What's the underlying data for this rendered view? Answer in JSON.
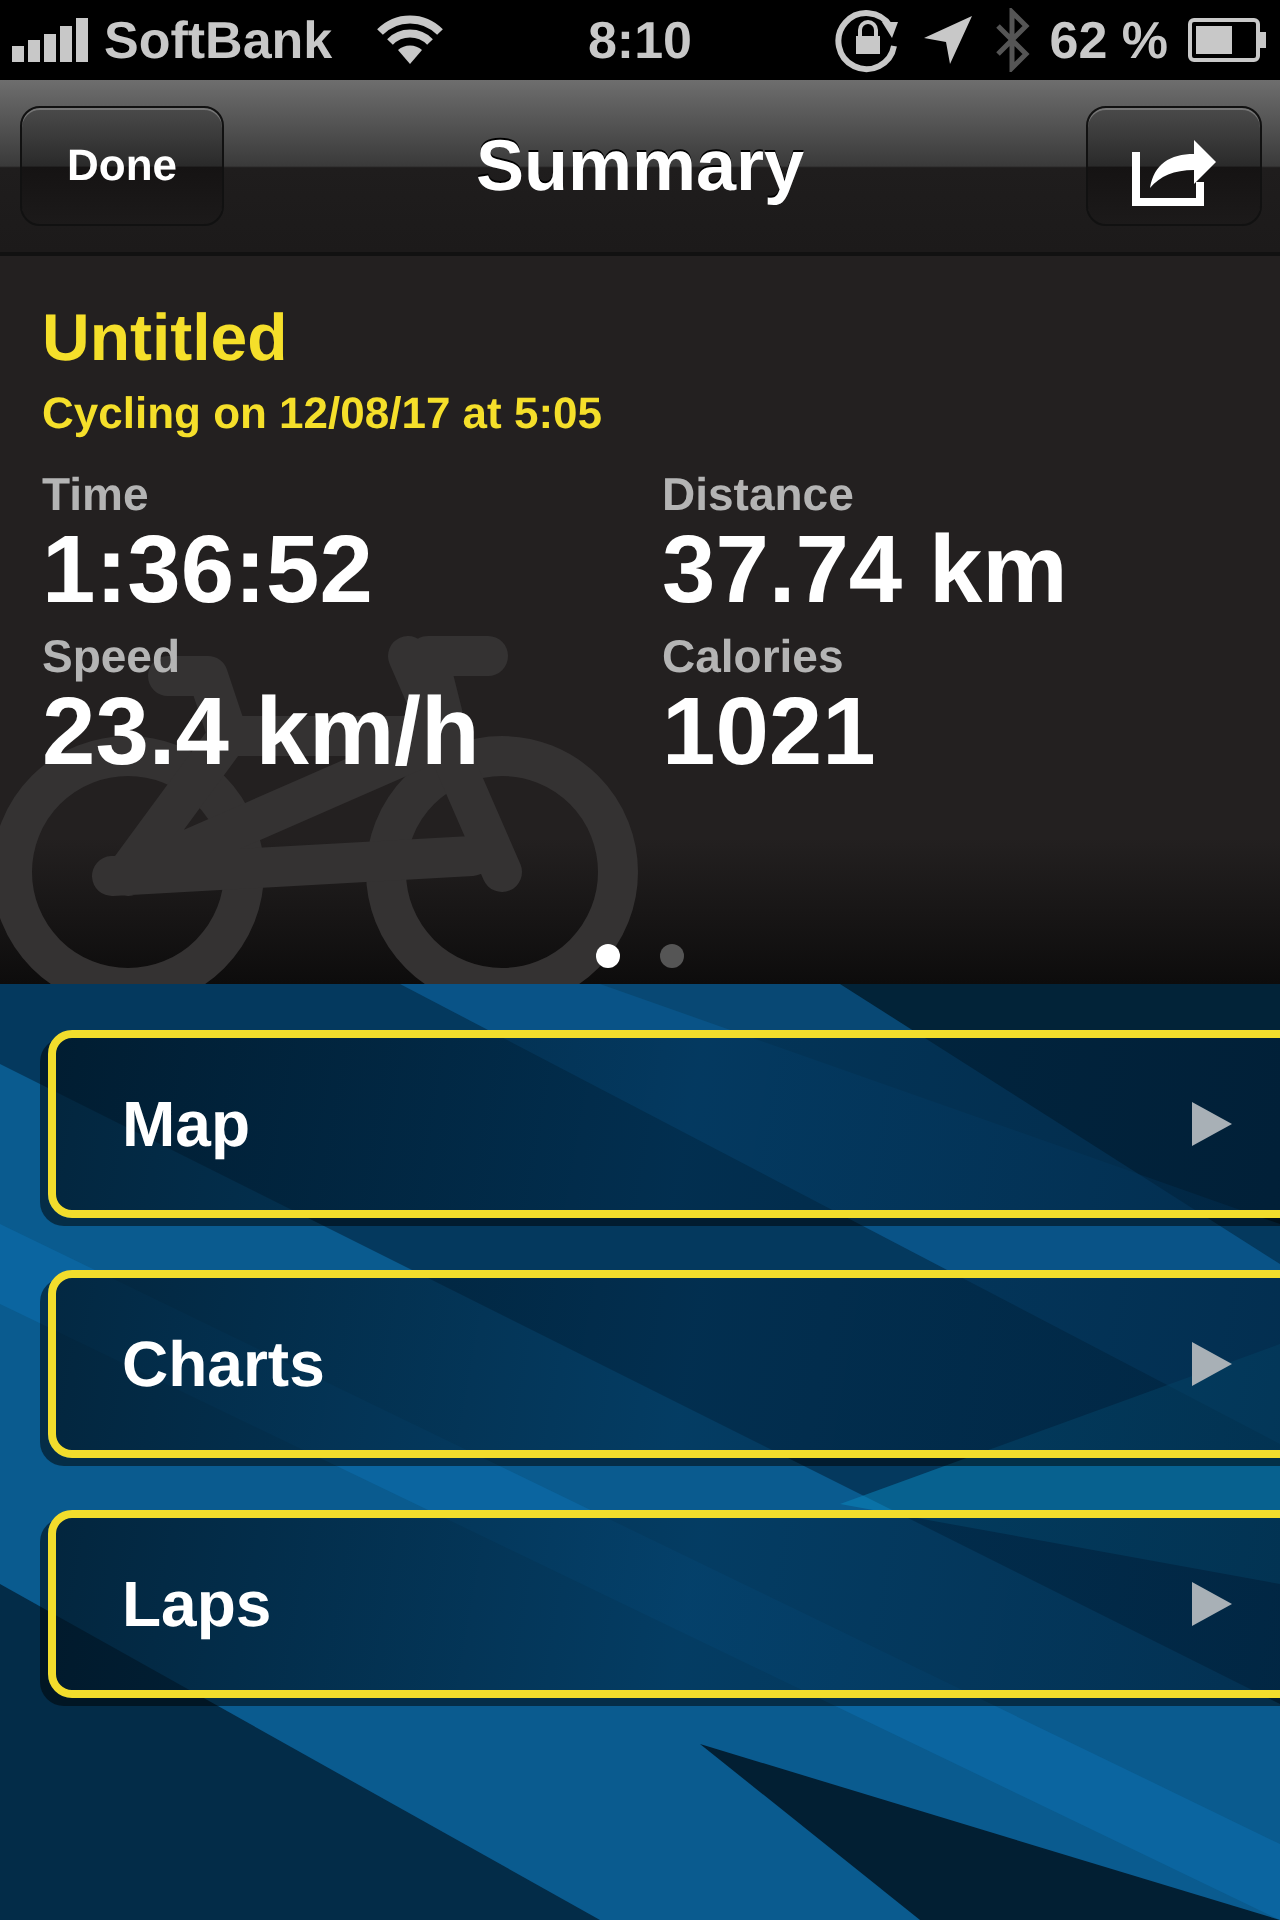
{
  "status_bar": {
    "carrier": "SoftBank",
    "time": "8:10",
    "battery": "62 %"
  },
  "nav_bar": {
    "title": "Summary",
    "left_button": "Done"
  },
  "summary": {
    "title": "Untitled",
    "subtitle": "Cycling on 12/08/17 at 5:05",
    "stats": [
      {
        "label": "Time",
        "value": "1:36:52"
      },
      {
        "label": "Distance",
        "value": "37.74 km"
      },
      {
        "label": "Speed",
        "value": "23.4 km/h"
      },
      {
        "label": "Calories",
        "value": "1021"
      }
    ],
    "pages": [
      {
        "selected": true
      },
      {
        "selected": false
      }
    ]
  },
  "menu": [
    {
      "label": "Map"
    },
    {
      "label": "Charts"
    },
    {
      "label": "Laps"
    }
  ]
}
